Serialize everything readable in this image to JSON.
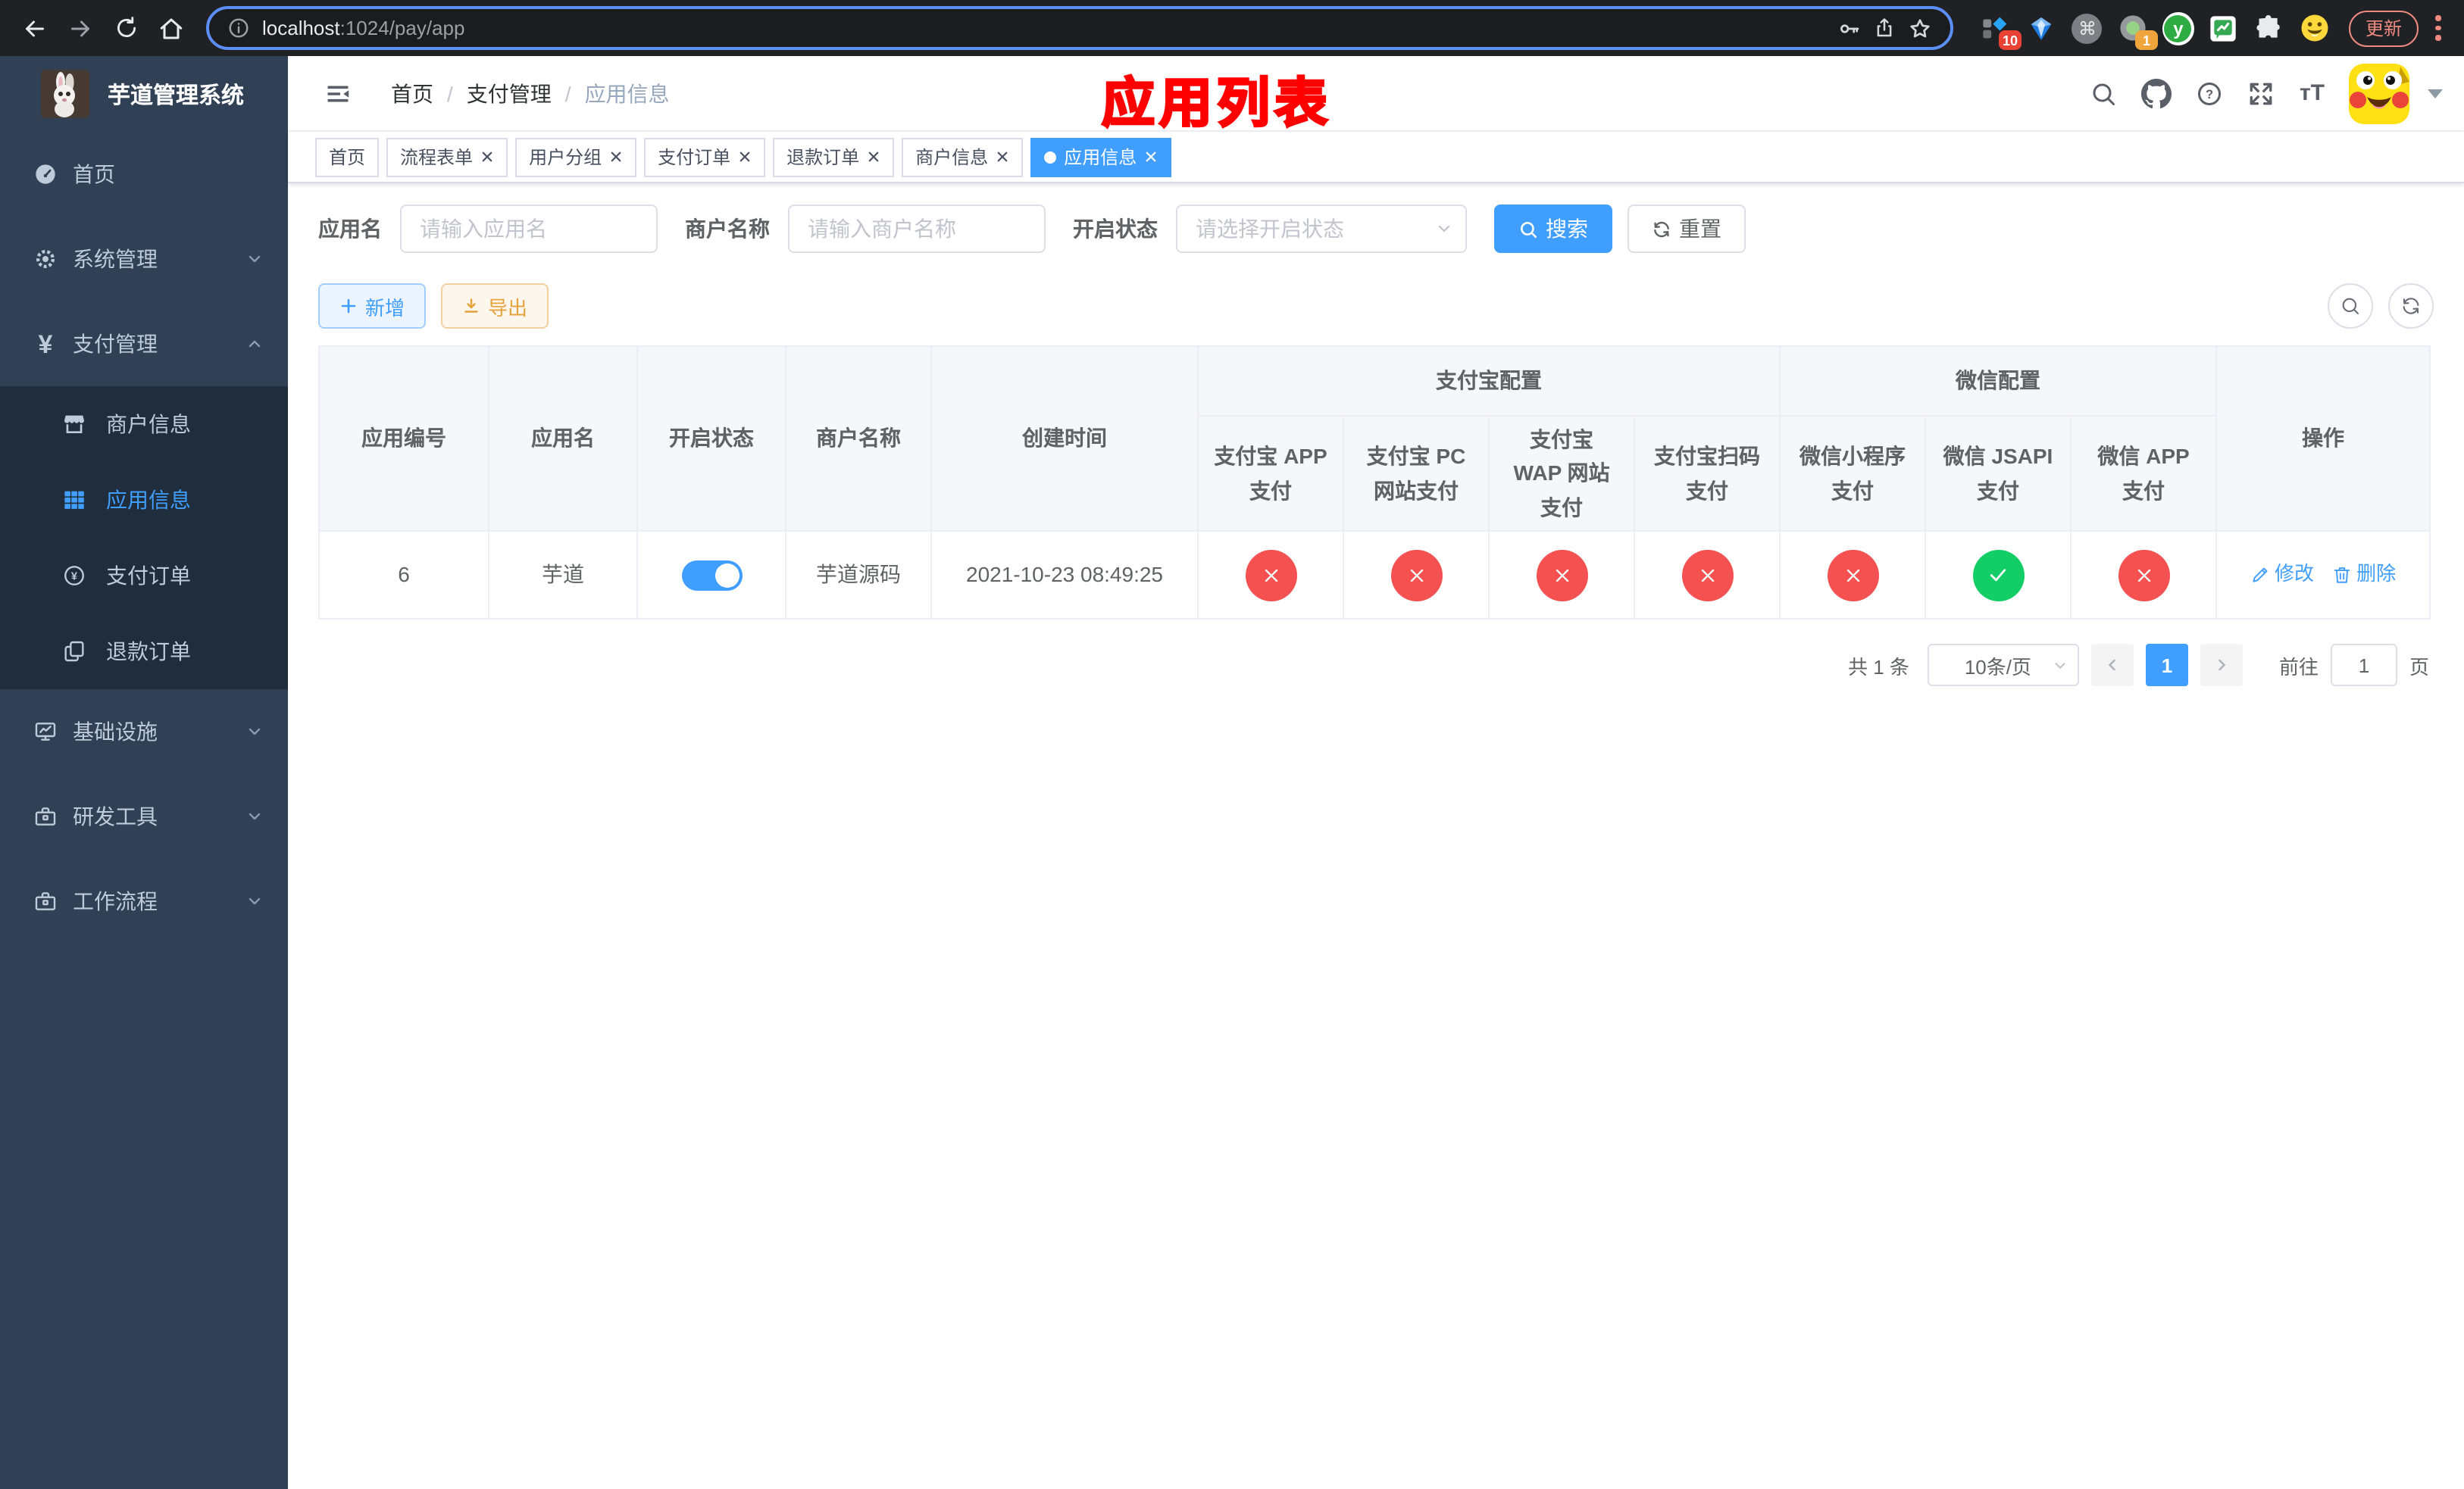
{
  "chrome": {
    "url_host": "localhost",
    "url_path": ":1024/pay/app",
    "update_button": "更新",
    "ext_badge_blue": "10",
    "ext_badge_rec": "1"
  },
  "glyphs": {
    "yen": "¥",
    "cmd": "⌘",
    "yudao_y": "y",
    "question": "?",
    "font_size": "тT"
  },
  "annotation": {
    "title": "应用列表"
  },
  "sidebar": {
    "title": "芋道管理系统",
    "menu": [
      {
        "label": "首页"
      },
      {
        "label": "系统管理"
      },
      {
        "label": "支付管理"
      },
      {
        "label": "商户信息"
      },
      {
        "label": "应用信息"
      },
      {
        "label": "支付订单"
      },
      {
        "label": "退款订单"
      },
      {
        "label": "基础设施"
      },
      {
        "label": "研发工具"
      },
      {
        "label": "工作流程"
      }
    ]
  },
  "navbar": {
    "breadcrumb": [
      "首页",
      "支付管理",
      "应用信息"
    ],
    "separator": "/"
  },
  "tags": [
    {
      "label": "首页",
      "closable": false,
      "active": false
    },
    {
      "label": "流程表单",
      "closable": true,
      "active": false
    },
    {
      "label": "用户分组",
      "closable": true,
      "active": false
    },
    {
      "label": "支付订单",
      "closable": true,
      "active": false
    },
    {
      "label": "退款订单",
      "closable": true,
      "active": false
    },
    {
      "label": "商户信息",
      "closable": true,
      "active": false
    },
    {
      "label": "应用信息",
      "closable": true,
      "active": true
    }
  ],
  "search": {
    "app_name_label": "应用名",
    "app_name_placeholder": "请输入应用名",
    "merchant_label": "商户名称",
    "merchant_placeholder": "请输入商户名称",
    "status_label": "开启状态",
    "status_placeholder": "请选择开启状态",
    "search_button": "搜索",
    "reset_button": "重置"
  },
  "toolbar": {
    "add_button": "新增",
    "export_button": "导出"
  },
  "table": {
    "headers": {
      "app_id": "应用编号",
      "app_name": "应用名",
      "status": "开启状态",
      "merchant": "商户名称",
      "create_time": "创建时间",
      "alipay_group": "支付宝配置",
      "wechat_group": "微信配置",
      "alipay_app": "支付宝 APP 支付",
      "alipay_pc": "支付宝 PC 网站支付",
      "alipay_wap": "支付宝 WAP 网站支付",
      "alipay_qr": "支付宝扫码支付",
      "wechat_lite": "微信小程序支付",
      "wechat_jsapi": "微信 JSAPI 支付",
      "wechat_app": "微信 APP 支付",
      "actions": "操作"
    },
    "rows": [
      {
        "app_id": "6",
        "app_name": "芋道",
        "status_on": true,
        "merchant": "芋道源码",
        "create_time": "2021-10-23 08:49:25",
        "alipay_app": false,
        "alipay_pc": false,
        "alipay_wap": false,
        "alipay_qr": false,
        "wechat_lite": false,
        "wechat_jsapi": true,
        "wechat_app": false,
        "edit_label": "修改",
        "delete_label": "删除"
      }
    ]
  },
  "pagination": {
    "total": "共 1 条",
    "page_size": "10条/页",
    "current_page": "1",
    "goto_label": "前往",
    "goto_value": "1",
    "goto_suffix": "页"
  },
  "colors": {
    "primary": "#409eff",
    "success": "#13ce66",
    "danger": "#f45151",
    "warning": "#e6a23c",
    "sidebar_bg": "#304156",
    "submenu_bg": "#1f2d3d"
  }
}
